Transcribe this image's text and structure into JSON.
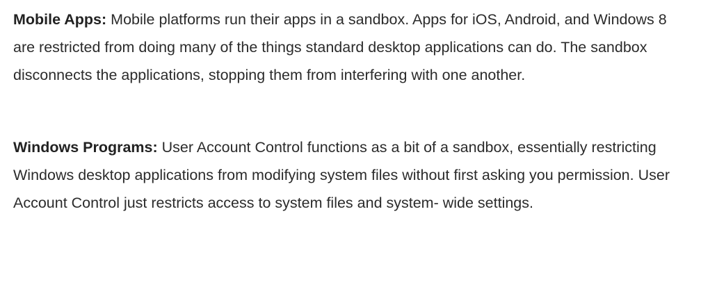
{
  "paragraphs": [
    {
      "term": "Mobile Apps:",
      "text": "Mobile platforms run their apps in a sandbox. Apps for iOS, Android, and Windows 8 are restricted from doing many of the things standard desktop applications can do. The sandbox disconnects the applications, stopping them from interfering with one another."
    },
    {
      "term": "Windows Programs:",
      "text": "User Account Control functions as a bit of a sandbox, essentially restricting Windows desktop applications from modifying system files without first asking you permission. User Account Control just restricts access to system files and system- wide settings."
    }
  ]
}
